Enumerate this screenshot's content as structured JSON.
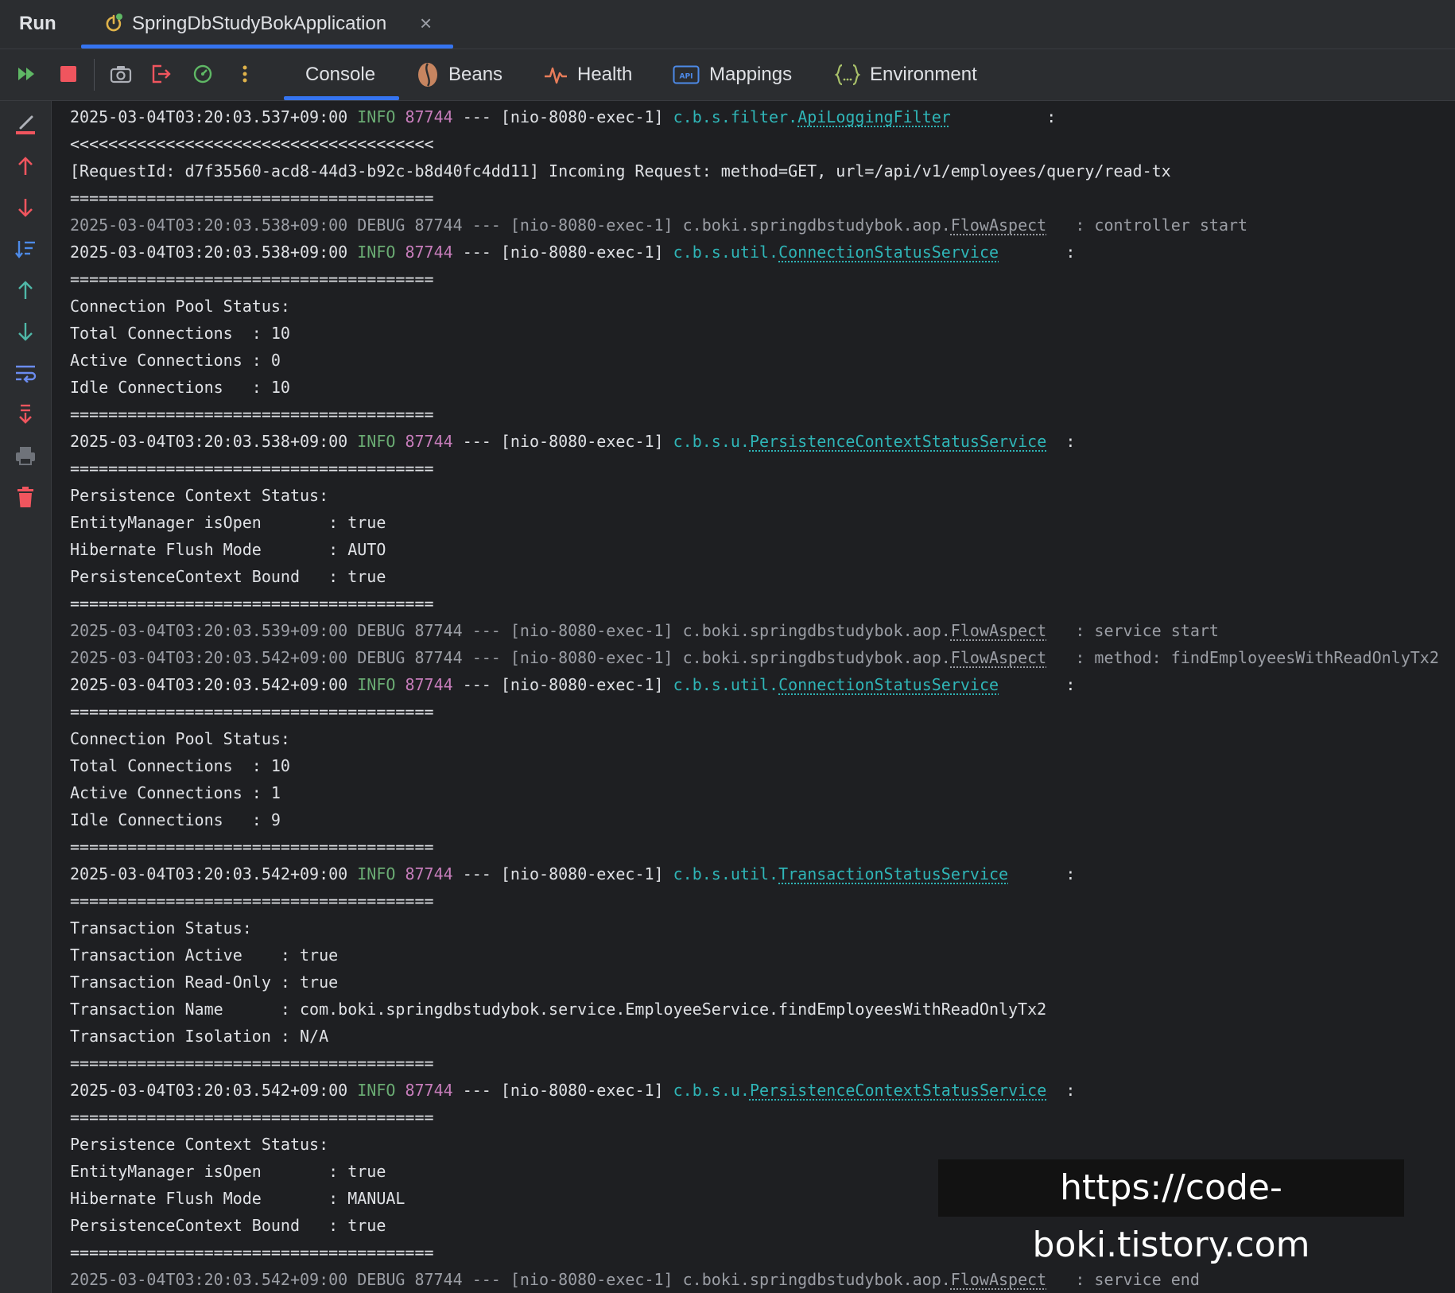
{
  "runbar": {
    "title": "Run",
    "tab_label": "SpringDbStudyBokApplication",
    "close_glyph": "×"
  },
  "toolbar": {
    "tabs": {
      "console": "Console",
      "beans": "Beans",
      "health": "Health",
      "mappings": "Mappings",
      "environment": "Environment"
    },
    "mappings_icon_text": "API"
  },
  "colors": {
    "accent": "#3574f0",
    "info": "#6aab73",
    "pid": "#c77dbb",
    "logger": "#2fb5b7",
    "stop": "#f0555e",
    "debug_text": "#9b9ea5"
  },
  "console": {
    "lines": [
      {
        "type": "log",
        "level": "info",
        "ts": "2025-03-04T03:20:03.537+09:00",
        "lvl": " INFO",
        "pid": "87744",
        "thread": " --- [nio-8080-exec-1] ",
        "logger_prefix": "c.b.s.filter.",
        "logger_name": "ApiLoggingFilter",
        "after": "          :"
      },
      {
        "type": "text",
        "text": "<<<<<<<<<<<<<<<<<<<<<<<<<<<<<<<<<<<<<<"
      },
      {
        "type": "text",
        "text": "[RequestId: d7f35560-acd8-44d3-b92c-b8d40fc4dd11] Incoming Request: method=GET, url=/api/v1/employees/query/read-tx"
      },
      {
        "type": "text",
        "text": "======================================"
      },
      {
        "type": "debug",
        "pre": "2025-03-04T03:20:03.538+09:00 DEBUG 87744 --- [nio-8080-exec-1] c.boki.springdbstudybok.aop.",
        "name": "FlowAspect",
        "post": "   : controller start"
      },
      {
        "type": "log",
        "level": "info",
        "ts": "2025-03-04T03:20:03.538+09:00",
        "lvl": " INFO",
        "pid": "87744",
        "thread": " --- [nio-8080-exec-1] ",
        "logger_prefix": "c.b.s.util.",
        "logger_name": "ConnectionStatusService",
        "after": "       :"
      },
      {
        "type": "text",
        "text": "======================================"
      },
      {
        "type": "text",
        "text": "Connection Pool Status:"
      },
      {
        "type": "text",
        "text": "Total Connections  : 10"
      },
      {
        "type": "text",
        "text": "Active Connections : 0"
      },
      {
        "type": "text",
        "text": "Idle Connections   : 10"
      },
      {
        "type": "text",
        "text": "======================================"
      },
      {
        "type": "log",
        "level": "info",
        "ts": "2025-03-04T03:20:03.538+09:00",
        "lvl": " INFO",
        "pid": "87744",
        "thread": " --- [nio-8080-exec-1] ",
        "logger_prefix": "c.b.s.u.",
        "logger_name": "PersistenceContextStatusService",
        "after": "  :"
      },
      {
        "type": "text",
        "text": "======================================"
      },
      {
        "type": "text",
        "text": "Persistence Context Status:"
      },
      {
        "type": "text",
        "text": "EntityManager isOpen       : true"
      },
      {
        "type": "text",
        "text": "Hibernate Flush Mode       : AUTO"
      },
      {
        "type": "text",
        "text": "PersistenceContext Bound   : true"
      },
      {
        "type": "text",
        "text": "======================================"
      },
      {
        "type": "debug",
        "pre": "2025-03-04T03:20:03.539+09:00 DEBUG 87744 --- [nio-8080-exec-1] c.boki.springdbstudybok.aop.",
        "name": "FlowAspect",
        "post": "   : service start"
      },
      {
        "type": "debug",
        "pre": "2025-03-04T03:20:03.542+09:00 DEBUG 87744 --- [nio-8080-exec-1] c.boki.springdbstudybok.aop.",
        "name": "FlowAspect",
        "post": "   : method: findEmployeesWithReadOnlyTx2"
      },
      {
        "type": "log",
        "level": "info",
        "ts": "2025-03-04T03:20:03.542+09:00",
        "lvl": " INFO",
        "pid": "87744",
        "thread": " --- [nio-8080-exec-1] ",
        "logger_prefix": "c.b.s.util.",
        "logger_name": "ConnectionStatusService",
        "after": "       :"
      },
      {
        "type": "text",
        "text": "======================================"
      },
      {
        "type": "text",
        "text": "Connection Pool Status:"
      },
      {
        "type": "text",
        "text": "Total Connections  : 10"
      },
      {
        "type": "text",
        "text": "Active Connections : 1"
      },
      {
        "type": "text",
        "text": "Idle Connections   : 9"
      },
      {
        "type": "text",
        "text": "======================================"
      },
      {
        "type": "log",
        "level": "info",
        "ts": "2025-03-04T03:20:03.542+09:00",
        "lvl": " INFO",
        "pid": "87744",
        "thread": " --- [nio-8080-exec-1] ",
        "logger_prefix": "c.b.s.util.",
        "logger_name": "TransactionStatusService",
        "after": "      :"
      },
      {
        "type": "text",
        "text": "======================================"
      },
      {
        "type": "text",
        "text": "Transaction Status:"
      },
      {
        "type": "text",
        "text": "Transaction Active    : true"
      },
      {
        "type": "text",
        "text": "Transaction Read-Only : true"
      },
      {
        "type": "text",
        "text": "Transaction Name      : com.boki.springdbstudybok.service.EmployeeService.findEmployeesWithReadOnlyTx2"
      },
      {
        "type": "text",
        "text": "Transaction Isolation : N/A"
      },
      {
        "type": "text",
        "text": "======================================"
      },
      {
        "type": "log",
        "level": "info",
        "ts": "2025-03-04T03:20:03.542+09:00",
        "lvl": " INFO",
        "pid": "87744",
        "thread": " --- [nio-8080-exec-1] ",
        "logger_prefix": "c.b.s.u.",
        "logger_name": "PersistenceContextStatusService",
        "after": "  :"
      },
      {
        "type": "text",
        "text": "======================================"
      },
      {
        "type": "text",
        "text": "Persistence Context Status:"
      },
      {
        "type": "text",
        "text": "EntityManager isOpen       : true"
      },
      {
        "type": "text",
        "text": "Hibernate Flush Mode       : MANUAL"
      },
      {
        "type": "text",
        "text": "PersistenceContext Bound   : true"
      },
      {
        "type": "text",
        "text": "======================================"
      },
      {
        "type": "debug",
        "pre": "2025-03-04T03:20:03.542+09:00 DEBUG 87744 --- [nio-8080-exec-1] c.boki.springdbstudybok.aop.",
        "name": "FlowAspect",
        "post": "   : service end"
      }
    ]
  },
  "watermark": "https://code-boki.tistory.com"
}
